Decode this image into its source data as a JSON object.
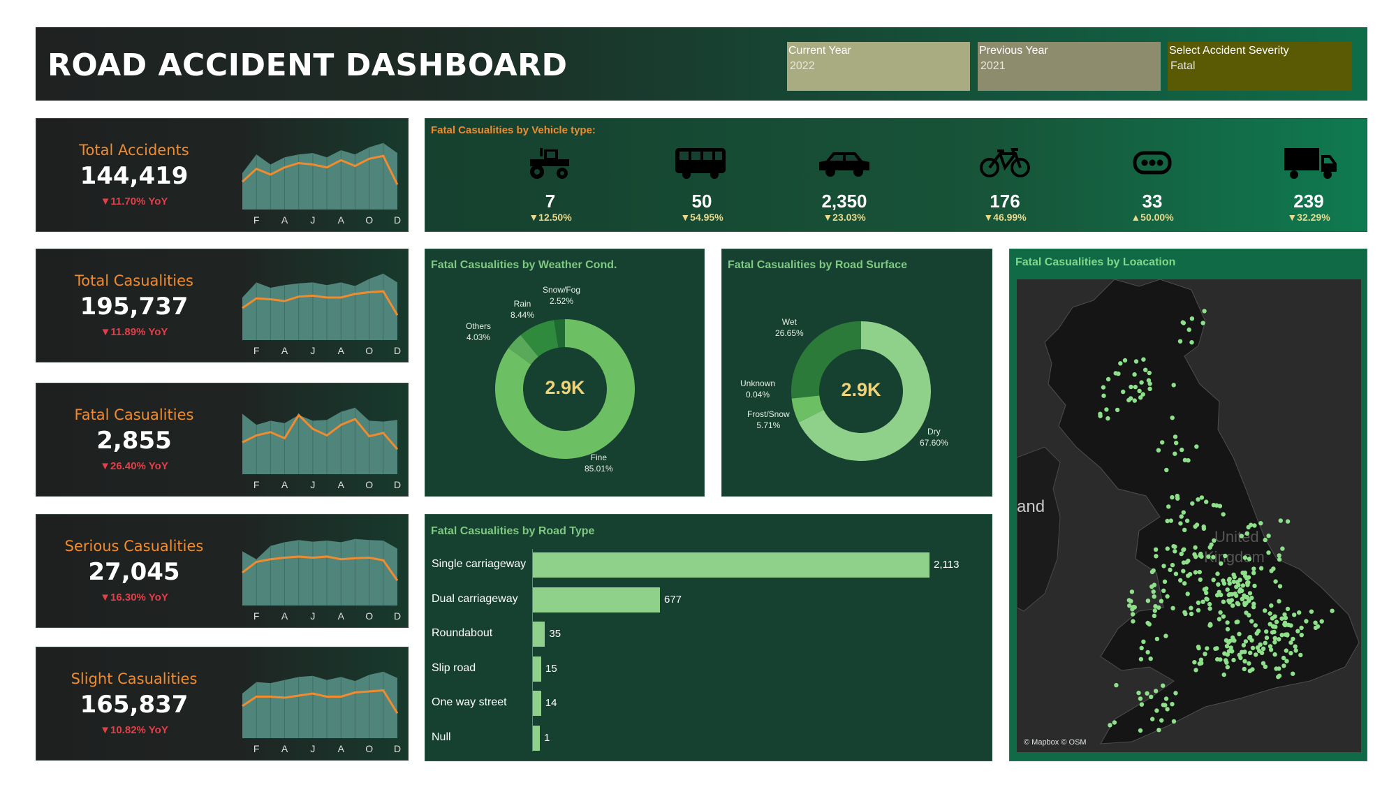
{
  "header": {
    "title": "ROAD ACCIDENT DASHBOARD",
    "filters": [
      {
        "label": "Current Year",
        "value": "2022",
        "color": "#a9ac80"
      },
      {
        "label": "Previous Year",
        "value": "2021",
        "color": "#8d8c6c"
      },
      {
        "label": "Select Accident Severity",
        "value": "Fatal",
        "color": "#5a5a05"
      }
    ]
  },
  "kpis": [
    {
      "title": "Total Accidents",
      "value": "144,419",
      "yoy": "▼11.70% YoY"
    },
    {
      "title": "Total Casualities",
      "value": "195,737",
      "yoy": "▼11.89% YoY"
    },
    {
      "title": "Fatal Casualities",
      "value": "2,855",
      "yoy": "▼26.40% YoY"
    },
    {
      "title": "Serious Casualities",
      "value": "27,045",
      "yoy": "▼16.30% YoY"
    },
    {
      "title": "Slight Casualities",
      "value": "165,837",
      "yoy": "▼10.82% YoY"
    }
  ],
  "vehicle": {
    "title": "Fatal Casualities by Vehicle type:",
    "items": [
      {
        "icon": "tractor-icon",
        "value": "7",
        "change": "▼12.50%"
      },
      {
        "icon": "bus-icon",
        "value": "50",
        "change": "▼54.95%"
      },
      {
        "icon": "car-icon",
        "value": "2,350",
        "change": "▼23.03%"
      },
      {
        "icon": "bicycle-icon",
        "value": "176",
        "change": "▼46.99%"
      },
      {
        "icon": "other-vehicle-icon",
        "value": "33",
        "change": "▲50.00%"
      },
      {
        "icon": "truck-icon",
        "value": "239",
        "change": "▼32.29%"
      }
    ]
  },
  "weather": {
    "title": "Fatal Casualities by Weather Cond.",
    "center": "2.9K",
    "labels": [
      {
        "name": "Fine",
        "pct": "85.01%"
      },
      {
        "name": "Others",
        "pct": "4.03%"
      },
      {
        "name": "Rain",
        "pct": "8.44%"
      },
      {
        "name": "Snow/Fog",
        "pct": "2.52%"
      }
    ]
  },
  "surface": {
    "title": "Fatal Casualities by Road Surface",
    "center": "2.9K",
    "labels": [
      {
        "name": "Dry",
        "pct": "67.60%"
      },
      {
        "name": "Frost/Snow",
        "pct": "5.71%"
      },
      {
        "name": "Unknown",
        "pct": "0.04%"
      },
      {
        "name": "Wet",
        "pct": "26.65%"
      }
    ]
  },
  "roadtype": {
    "title": "Fatal  Casualities by Road Type",
    "labels": [
      "Single carriageway",
      "Dual carriageway",
      "Roundabout",
      "Slip road",
      "One way street",
      "Null"
    ],
    "values": [
      "2,113",
      "677",
      "35",
      "15",
      "14",
      "1"
    ]
  },
  "location": {
    "title": "Fatal Casualities by Loacation",
    "credit": "© Mapbox © OSM",
    "map_text": [
      "and",
      "United",
      "Kingdom"
    ]
  },
  "chart_data": [
    {
      "type": "area",
      "title": "Total Accidents",
      "categories": [
        "J",
        "F",
        "M",
        "A",
        "M",
        "J",
        "J",
        "A",
        "S",
        "O",
        "N",
        "D"
      ],
      "series": [
        {
          "name": "Current Year",
          "values": [
            11200,
            12100,
            11700,
            12200,
            12500,
            12400,
            12200,
            12700,
            12300,
            12800,
            13000,
            11000
          ]
        },
        {
          "name": "Previous Year",
          "values": [
            11800,
            13100,
            12400,
            12900,
            13100,
            13200,
            12900,
            13400,
            13100,
            13600,
            13900,
            13200
          ]
        }
      ],
      "x_tick_labels": [
        "F",
        "A",
        "J",
        "A",
        "O",
        "D"
      ]
    },
    {
      "type": "area",
      "title": "Total Casualities",
      "categories": [
        "J",
        "F",
        "M",
        "A",
        "M",
        "J",
        "J",
        "A",
        "S",
        "O",
        "N",
        "D"
      ],
      "series": [
        {
          "name": "Current Year",
          "values": [
            15300,
            16400,
            16300,
            16100,
            16600,
            16700,
            16500,
            16500,
            16900,
            17100,
            17200,
            14500
          ]
        },
        {
          "name": "Previous Year",
          "values": [
            16500,
            18200,
            17600,
            17900,
            18100,
            18200,
            17900,
            18200,
            17800,
            18600,
            19200,
            18200
          ]
        }
      ],
      "x_tick_labels": [
        "F",
        "A",
        "J",
        "A",
        "O",
        "D"
      ]
    },
    {
      "type": "area",
      "title": "Fatal Casualities",
      "categories": [
        "J",
        "F",
        "M",
        "A",
        "M",
        "J",
        "J",
        "A",
        "S",
        "O",
        "N",
        "D"
      ],
      "series": [
        {
          "name": "Current Year",
          "values": [
            215,
            232,
            240,
            225,
            282,
            248,
            232,
            258,
            272,
            230,
            238,
            198
          ]
        },
        {
          "name": "Previous Year",
          "values": [
            285,
            258,
            268,
            262,
            282,
            268,
            270,
            290,
            300,
            268,
            266,
            270
          ]
        }
      ],
      "x_tick_labels": [
        "F",
        "A",
        "J",
        "A",
        "O",
        "D"
      ]
    },
    {
      "type": "area",
      "title": "Serious Casualities",
      "categories": [
        "J",
        "F",
        "M",
        "A",
        "M",
        "J",
        "J",
        "A",
        "S",
        "O",
        "N",
        "D"
      ],
      "series": [
        {
          "name": "Current Year",
          "values": [
            2050,
            2250,
            2300,
            2330,
            2350,
            2330,
            2350,
            2300,
            2320,
            2330,
            2280,
            1900
          ]
        },
        {
          "name": "Previous Year",
          "values": [
            2450,
            2300,
            2550,
            2620,
            2660,
            2630,
            2650,
            2620,
            2680,
            2660,
            2650,
            2500
          ]
        }
      ],
      "x_tick_labels": [
        "F",
        "A",
        "J",
        "A",
        "O",
        "D"
      ]
    },
    {
      "type": "area",
      "title": "Slight Casualities",
      "categories": [
        "J",
        "F",
        "M",
        "A",
        "M",
        "J",
        "J",
        "A",
        "S",
        "O",
        "N",
        "D"
      ],
      "series": [
        {
          "name": "Current Year",
          "values": [
            12900,
            13800,
            13800,
            13700,
            13900,
            14100,
            13800,
            13800,
            14200,
            14300,
            14400,
            12200
          ]
        },
        {
          "name": "Previous Year",
          "values": [
            14100,
            15200,
            15100,
            15400,
            15700,
            15800,
            15400,
            15700,
            15300,
            15900,
            16200,
            15600
          ]
        }
      ],
      "x_tick_labels": [
        "F",
        "A",
        "J",
        "A",
        "O",
        "D"
      ]
    },
    {
      "type": "pie",
      "title": "Fatal Casualities by Weather Cond.",
      "categories": [
        "Fine",
        "Others",
        "Rain",
        "Snow/Fog"
      ],
      "values": [
        85.01,
        4.03,
        8.44,
        2.52
      ],
      "colors": [
        "#6cbf62",
        "#5aa85a",
        "#2f8a3e",
        "#1f6a33"
      ]
    },
    {
      "type": "pie",
      "title": "Fatal Casualities by Road Surface",
      "categories": [
        "Dry",
        "Frost/Snow",
        "Unknown",
        "Wet"
      ],
      "values": [
        67.6,
        5.71,
        0.04,
        26.65
      ],
      "colors": [
        "#8fd18a",
        "#6cbf62",
        "#4e9a4e",
        "#2c7a3a"
      ]
    },
    {
      "type": "bar",
      "title": "Fatal  Casualities by Road Type",
      "categories": [
        "Single carriageway",
        "Dual carriageway",
        "Roundabout",
        "Slip road",
        "One way street",
        "Null"
      ],
      "values": [
        2113,
        677,
        35,
        15,
        14,
        1
      ],
      "orientation": "horizontal"
    }
  ]
}
